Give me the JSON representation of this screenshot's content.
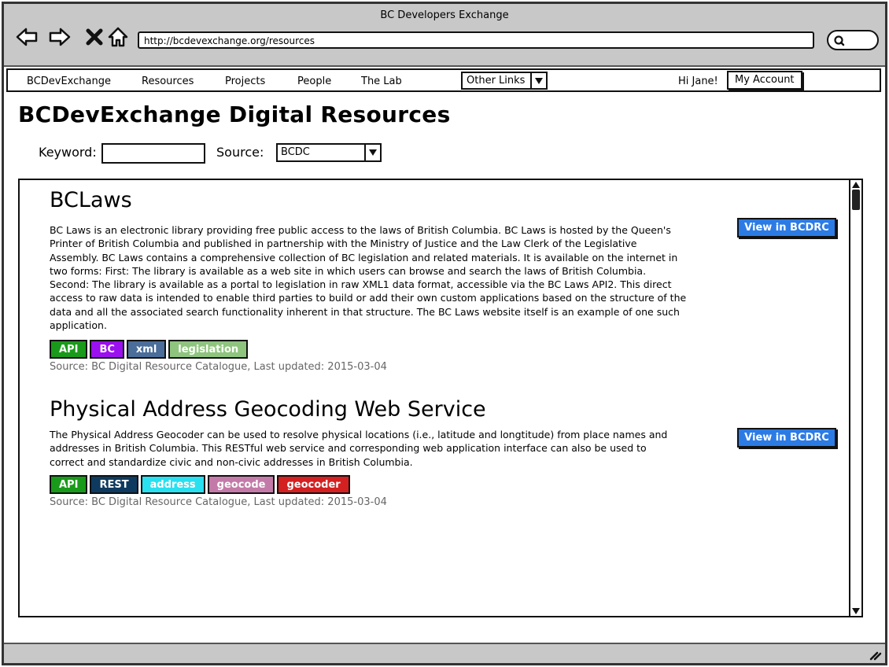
{
  "window": {
    "title": "BC Developers Exchange"
  },
  "browser": {
    "url": "http://bcdevexchange.org/resources"
  },
  "nav": {
    "items": [
      "BCDevExchange",
      "Resources",
      "Projects",
      "People",
      "The Lab"
    ],
    "other_links": "Other Links",
    "greeting": "Hi Jane!",
    "account": "My Account"
  },
  "page": {
    "title": "BCDevExchange Digital Resources",
    "keyword_label": "Keyword:",
    "keyword_value": "",
    "source_label": "Source:",
    "source_value": "BCDC"
  },
  "resources": [
    {
      "title": "BCLaws",
      "description_lines": [
        "BC Laws is an electronic library providing free public access to the laws of British Columbia. BC Laws is hosted by the Queen's",
        "Printer of British Columbia and published in partnership with the Ministry of Justice and the Law Clerk of the Legislative",
        "Assembly. BC Laws contains a comprehensive collection of BC legislation and related materials. It is available on the internet in",
        "two forms: First: The library is available as a web site in which users can browse and search the laws of British Columbia.",
        "Second: The library is available as a portal to legislation in raw XML1 data format, accessible via the BC Laws API2. This direct",
        "access to raw data is intended to enable third parties to build or add their own custom applications based on the structure of the",
        "data and all the associated search functionality inherent in that structure. The BC Laws website itself is an example of one such",
        "application."
      ],
      "tags": [
        {
          "label": "API",
          "color": "#1a9a1a"
        },
        {
          "label": "BC",
          "color": "#9b10ee"
        },
        {
          "label": "xml",
          "color": "#4a6d9a"
        },
        {
          "label": "legislation",
          "color": "#8fc47e"
        }
      ],
      "source": "Source: BC Digital Resource Catalogue, Last updated: 2015-03-04",
      "button": "View in BCDRC"
    },
    {
      "title": "Physical Address Geocoding Web Service",
      "description_lines": [
        "The Physical Address Geocoder can be used to resolve physical locations (i.e., latitude and longtitude) from place names and",
        "addresses in British Columbia. This RESTful web service and corresponding web application interface can also be used to",
        "correct and standardize civic and non-civic addresses in British Columbia."
      ],
      "tags": [
        {
          "label": "API",
          "color": "#1a9a1a"
        },
        {
          "label": "REST",
          "color": "#0f3a5f"
        },
        {
          "label": "address",
          "color": "#28e0f0"
        },
        {
          "label": "geocode",
          "color": "#c47aa8"
        },
        {
          "label": "geocoder",
          "color": "#d42020"
        }
      ],
      "source": "Source: BC Digital Resource Catalogue, Last updated: 2015-03-04",
      "button": "View in BCDRC"
    }
  ]
}
